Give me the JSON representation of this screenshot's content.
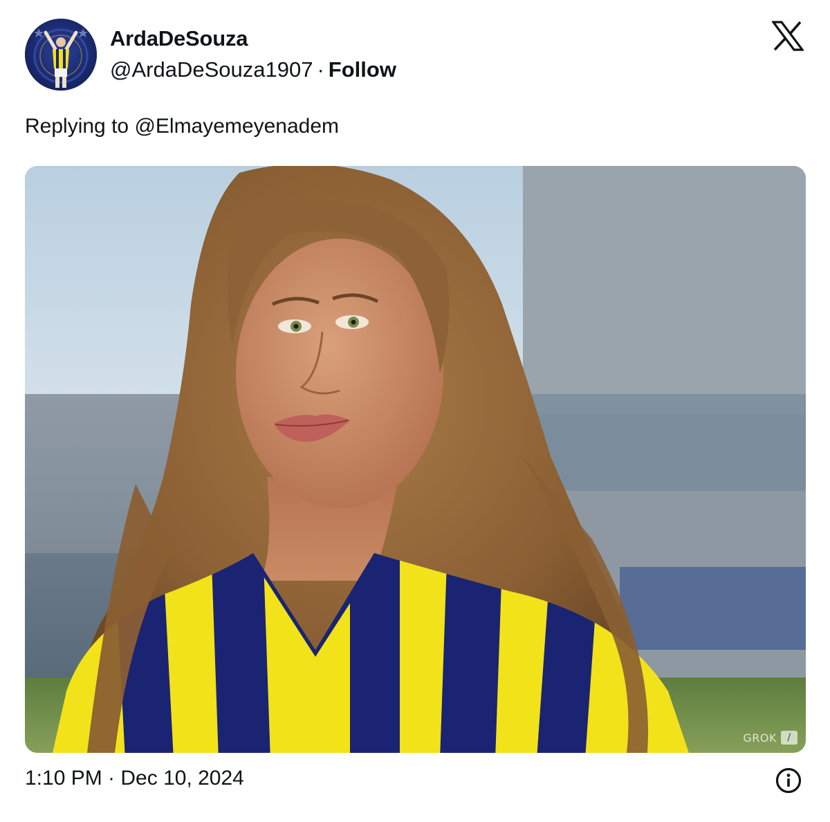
{
  "tweet": {
    "display_name": "ArdaDeSouza",
    "handle": "@ArdaDeSouza1907",
    "separator": "·",
    "follow_label": "Follow",
    "reply_prefix": "Replying to",
    "reply_to": "@Elmayemeyenadem",
    "timestamp": "1:10 PM · Dec 10, 2024"
  },
  "media": {
    "watermark_text": "GROK",
    "watermark_icon": "slash-square-icon"
  },
  "icons": {
    "brand": "x-logo-icon",
    "info": "info-icon"
  },
  "colors": {
    "text": "#0f1419",
    "jersey_yellow": "#f2e21a",
    "jersey_navy": "#1a2472",
    "avatar_bg": "#1b2a6b"
  }
}
